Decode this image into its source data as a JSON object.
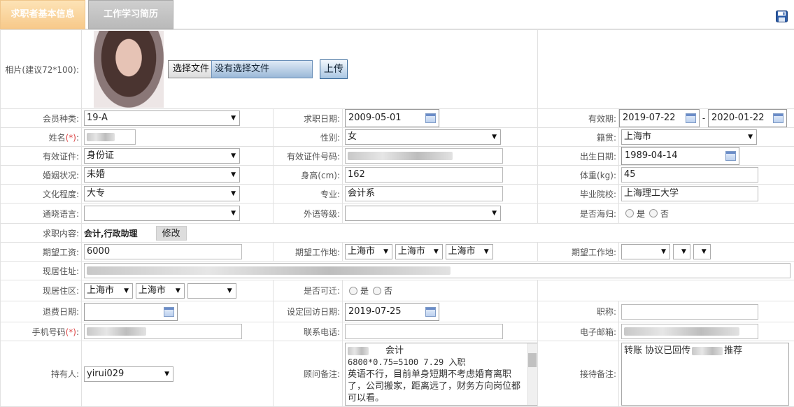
{
  "tabs": {
    "basic": "求职者基本信息",
    "resume": "工作学习简历"
  },
  "icons": {
    "save": "save-icon",
    "calendar": "calendar-icon"
  },
  "photo": {
    "label": "相片(建议72*100):",
    "choose_file": "选择文件",
    "no_file": "没有选择文件",
    "upload": "上传"
  },
  "row_member": {
    "label": "会员种类:",
    "value": "19-A",
    "apply_label": "求职日期:",
    "apply_value": "2009-05-01",
    "valid_label": "有效期:",
    "valid_from": "2019-07-22",
    "sep": "-",
    "valid_to": "2020-01-22"
  },
  "row_name": {
    "label": "姓名",
    "req": "(*)",
    "colon": ":",
    "gender_label": "性别:",
    "gender_value": "女",
    "native_label": "籍贯:",
    "native_value": "上海市"
  },
  "row_id": {
    "label": "有效证件:",
    "value": "身份证",
    "number_label": "有效证件号码:",
    "birth_label": "出生日期:",
    "birth_value": "1989-04-14"
  },
  "row_marital": {
    "label": "婚姻状况:",
    "value": "未婚",
    "height_label": "身高(cm):",
    "height_value": "162",
    "weight_label": "体重(kg):",
    "weight_value": "45"
  },
  "row_edu": {
    "label": "文化程度:",
    "value": "大专",
    "major_label": "专业:",
    "major_value": "会计系",
    "school_label": "毕业院校:",
    "school_value": "上海理工大学"
  },
  "row_lang": {
    "label": "通晓语言:",
    "value": "",
    "level_label": "外语等级:",
    "level_value": "",
    "abroad_label": "是否海归:",
    "yes": "是",
    "no": "否"
  },
  "row_job": {
    "label": "求职内容:",
    "value": "会计,行政助理",
    "modify": "修改"
  },
  "row_salary": {
    "label": "期望工资:",
    "value": "6000",
    "loc_label": "期望工作地:",
    "loc1": "上海市",
    "loc2": "上海市",
    "loc3": "上海市",
    "loc2_label": "期望工作地:"
  },
  "row_address": {
    "label": "现居住址:"
  },
  "row_area": {
    "label": "现居住区:",
    "a1": "上海市",
    "a2": "上海市",
    "a3": "",
    "relocate_label": "是否可迁:",
    "yes": "是",
    "no": "否"
  },
  "row_refund": {
    "label": "退费日期:",
    "visit_label": "设定回访日期:",
    "visit_value": "2019-07-25",
    "title_label": "职称:"
  },
  "row_phone": {
    "label": "手机号码",
    "req": "(*)",
    "colon": ":",
    "contact_label": "联系电话:",
    "email_label": "电子邮箱:"
  },
  "row_holder": {
    "label": "持有人:",
    "value": "yirui029",
    "advisor_label": "顾问备注:",
    "advisor_line1": "会计",
    "advisor_line2": "6800*0.75=5100  7.29 入职",
    "advisor_line3": "英语不行，目前单身短期不考虑婚育离职了，公司搬家，距离远了，财务方向岗位都可以看。",
    "reception_label": "接待备注:",
    "reception_text1": "转账 协议已回传",
    "reception_text2": "推荐"
  }
}
